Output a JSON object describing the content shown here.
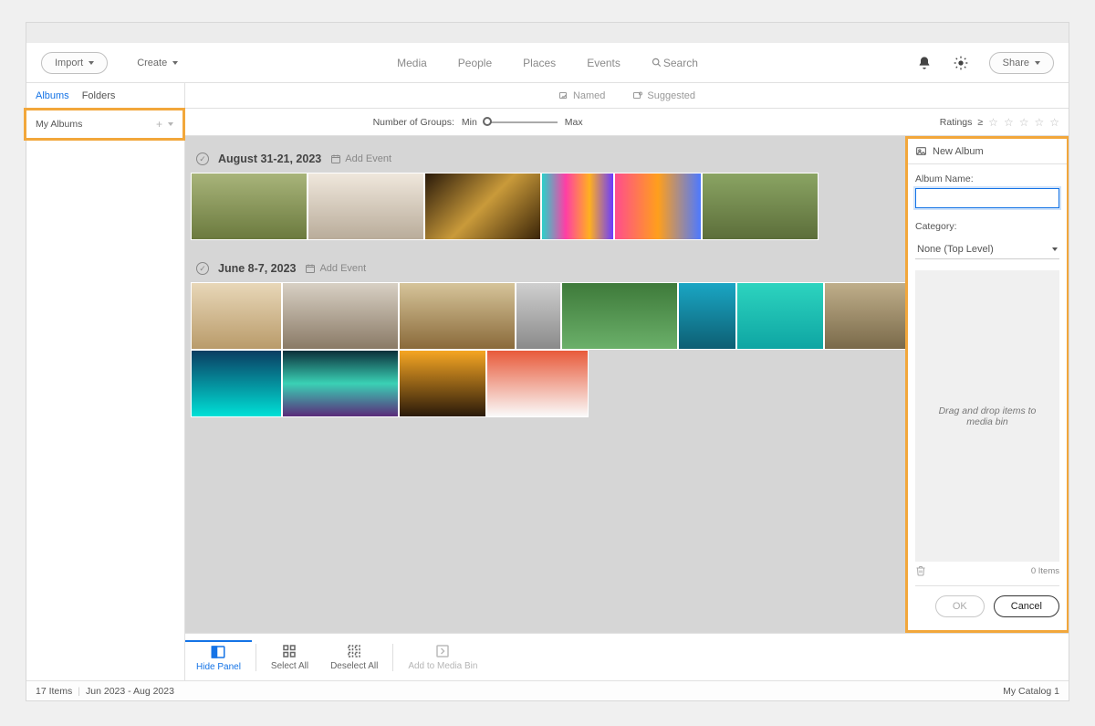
{
  "toolbar": {
    "import": "Import",
    "create": "Create",
    "share": "Share"
  },
  "nav": {
    "media": "Media",
    "people": "People",
    "places": "Places",
    "events": "Events",
    "search": "Search"
  },
  "sidebar": {
    "tabs": {
      "albums": "Albums",
      "folders": "Folders"
    },
    "my_albums": "My Albums"
  },
  "sub": {
    "named": "Named",
    "suggested": "Suggested"
  },
  "filter": {
    "groups_label": "Number of Groups:",
    "min": "Min",
    "max": "Max",
    "ratings_label": "Ratings",
    "gte": "≥"
  },
  "groups": {
    "g1_title": "August 31-21, 2023",
    "g2_title": "June 8-7, 2023",
    "add_event": "Add Event"
  },
  "panel": {
    "title": "New Album",
    "name_label": "Album Name:",
    "name_value": "",
    "category_label": "Category:",
    "category_value": "None (Top Level)",
    "dropzone": "Drag and drop items to media bin",
    "items_count": "0 Items",
    "ok": "OK",
    "cancel": "Cancel"
  },
  "bottom": {
    "hide_panel": "Hide Panel",
    "select_all": "Select All",
    "deselect_all": "Deselect All",
    "add_to_bin": "Add to Media Bin"
  },
  "status": {
    "items": "17 Items",
    "range": "Jun 2023 - Aug 2023",
    "catalog": "My Catalog 1"
  },
  "thumbs": {
    "g1": [
      {
        "w": 128,
        "g": "linear-gradient(#a8b47a,#6b7a3e)"
      },
      {
        "w": 128,
        "g": "linear-gradient(#efe7dc,#b9ac9a)"
      },
      {
        "w": 128,
        "g": "linear-gradient(135deg,#2a1a0a,#c99a3a,#3a2408)"
      },
      {
        "w": 80,
        "g": "linear-gradient(90deg,#2ad1c9,#ff3ea5,#ffb020,#6a3cff)"
      },
      {
        "w": 96,
        "g": "linear-gradient(90deg,#ff4d8d,#ff9f1c,#4d79ff)"
      },
      {
        "w": 128,
        "g": "linear-gradient(#8aa463,#5c6e3a)"
      }
    ],
    "g2": [
      {
        "w": 100,
        "g": "linear-gradient(#e8d7b8,#b99b6a)"
      },
      {
        "w": 128,
        "g": "linear-gradient(#d8d0c4,#8a7a66)"
      },
      {
        "w": 128,
        "g": "linear-gradient(#d6c49a,#8a6a3a)"
      },
      {
        "w": 50,
        "g": "linear-gradient(#cfcfcf,#8a8a8a)"
      },
      {
        "w": 128,
        "g": "linear-gradient(#3e7a3a,#6bb06a)"
      },
      {
        "w": 64,
        "g": "linear-gradient(#1aa6c4,#0d5f73)"
      },
      {
        "w": 96,
        "g": "linear-gradient(#2dd4bf,#0ea5a3)"
      },
      {
        "w": 96,
        "g": "linear-gradient(#bfae8a,#7a6a4a)"
      },
      {
        "w": 100,
        "g": "linear-gradient(#0a3d62,#00e0d6)"
      },
      {
        "w": 128,
        "g": "linear-gradient(#0b2f3a,#3ad1b5,#5a2b7a)"
      },
      {
        "w": 96,
        "g": "linear-gradient(#f6a623,#2a1a0a)"
      },
      {
        "w": 112,
        "g": "linear-gradient(#e85a3a,#fafafa)"
      }
    ]
  }
}
